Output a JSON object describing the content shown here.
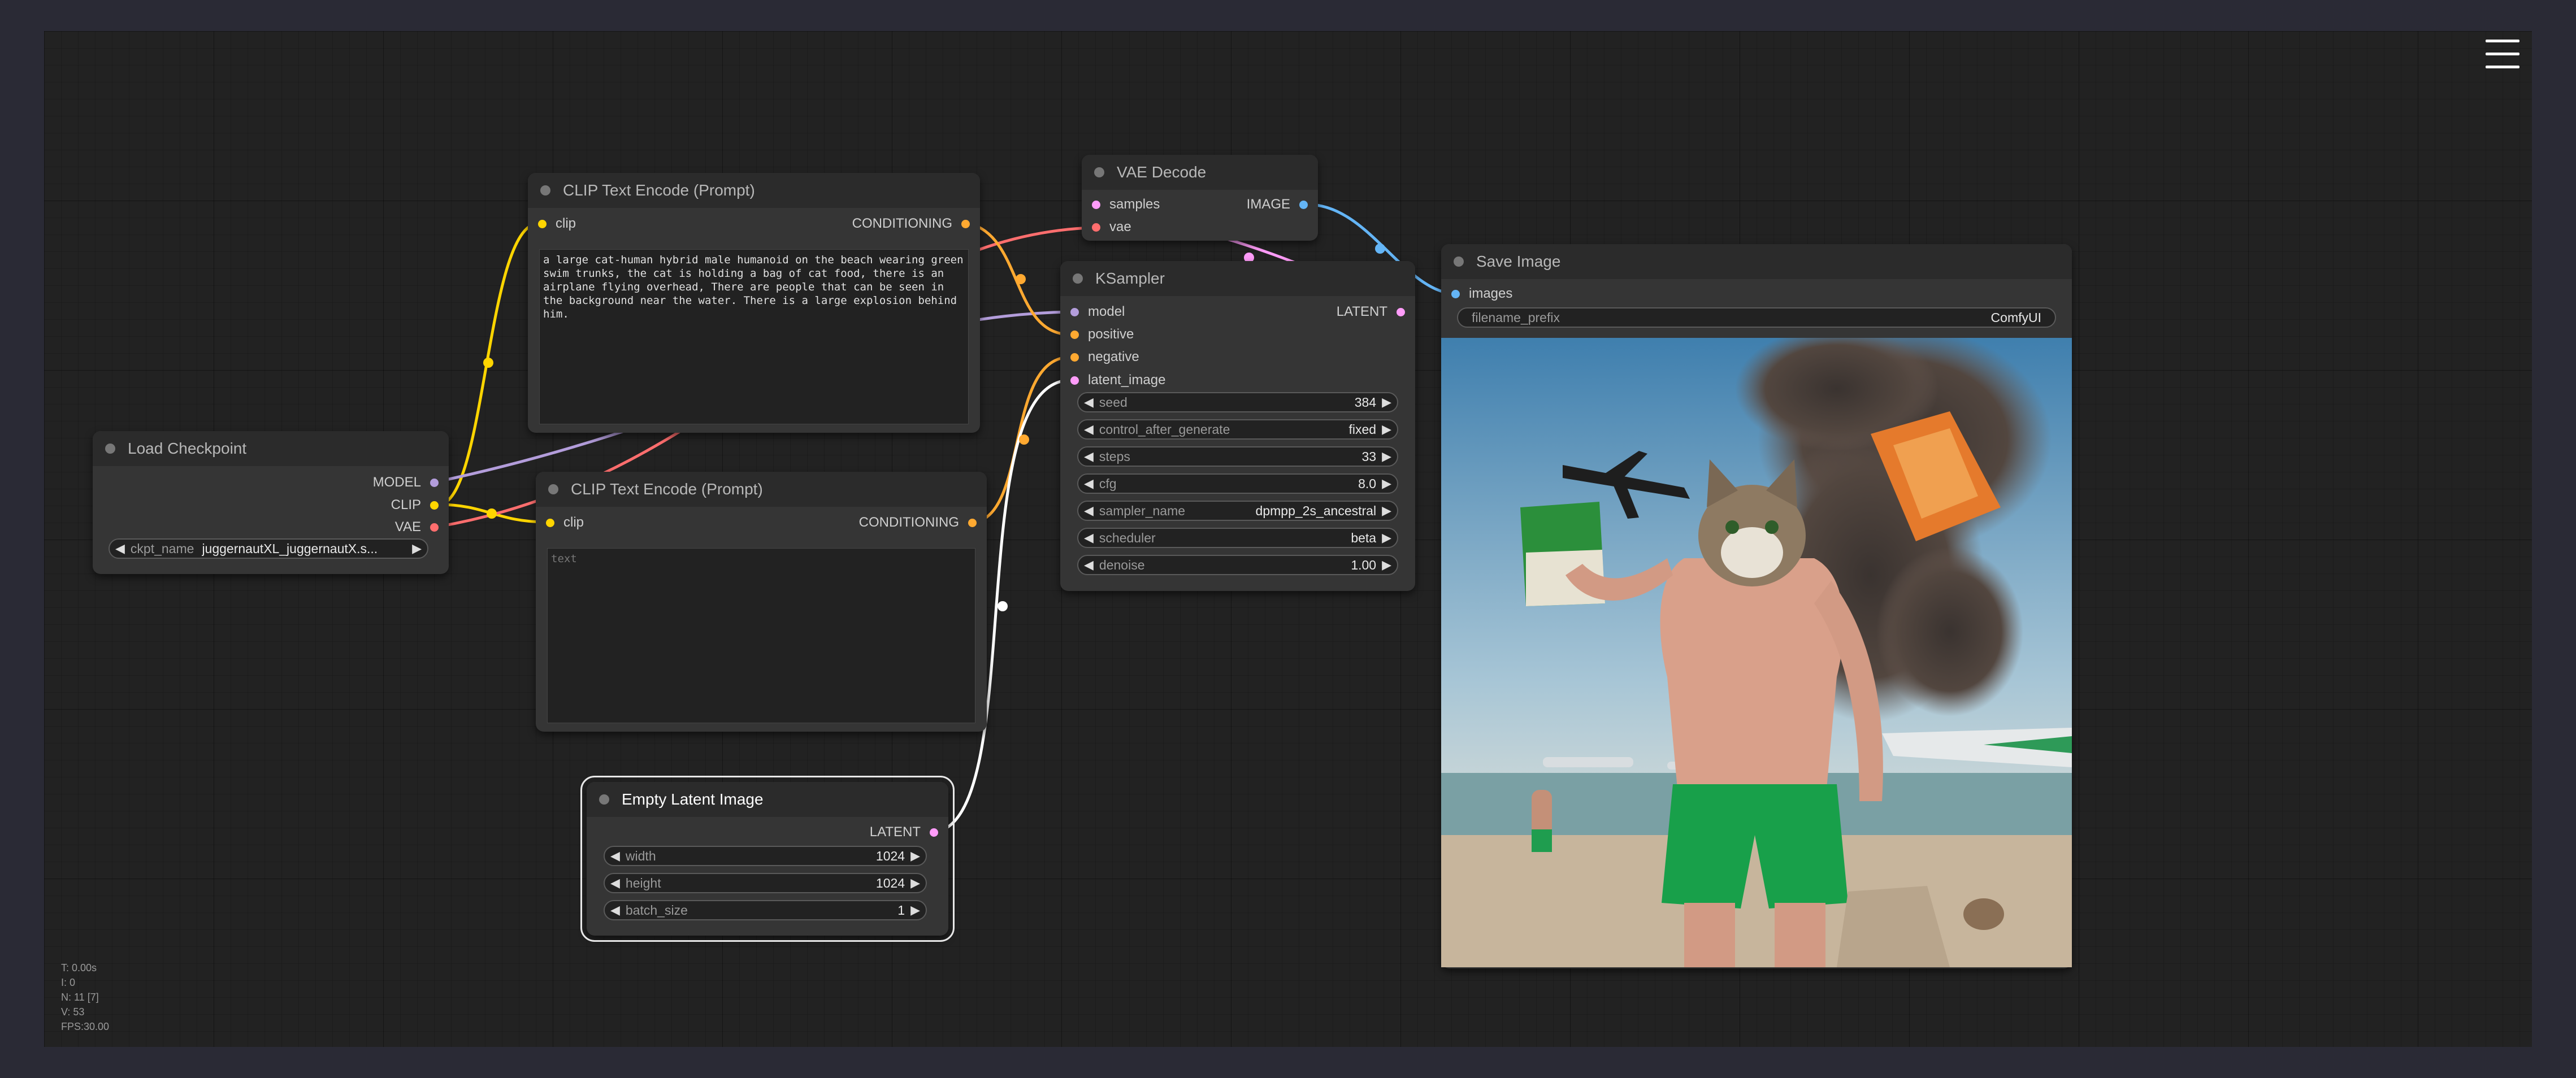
{
  "app": {
    "menu_icon": "hamburger-menu-icon"
  },
  "colors": {
    "clip": "#ffd500",
    "model": "#b39ddb",
    "vae": "#ff6e6e",
    "conditioning": "#ffa931",
    "latent": "#ff9cf9",
    "image": "#64b5f6"
  },
  "load_checkpoint": {
    "title": "Load Checkpoint",
    "outputs": [
      "MODEL",
      "CLIP",
      "VAE"
    ],
    "ckpt_label": "ckpt_name",
    "ckpt_value": "juggernautXL_juggernautX.s..."
  },
  "clip_pos": {
    "title": "CLIP Text Encode (Prompt)",
    "input": "clip",
    "output": "CONDITIONING",
    "text": "a large cat-human hybrid male humanoid on the beach wearing green swim trunks, the cat is holding a bag of cat food, there is an airplane flying overhead, There are people that can be seen in the background near the water. There is a large explosion behind him."
  },
  "clip_neg": {
    "title": "CLIP Text Encode (Prompt)",
    "input": "clip",
    "output": "CONDITIONING",
    "placeholder": "text"
  },
  "empty_latent": {
    "title": "Empty Latent Image",
    "output": "LATENT",
    "widgets": [
      {
        "label": "width",
        "value": "1024"
      },
      {
        "label": "height",
        "value": "1024"
      },
      {
        "label": "batch_size",
        "value": "1"
      }
    ]
  },
  "vae_decode": {
    "title": "VAE Decode",
    "inputs": [
      "samples",
      "vae"
    ],
    "output": "IMAGE"
  },
  "ksampler": {
    "title": "KSampler",
    "inputs": [
      "model",
      "positive",
      "negative",
      "latent_image"
    ],
    "output": "LATENT",
    "widgets": [
      {
        "label": "seed",
        "value": "384"
      },
      {
        "label": "control_after_generate",
        "value": "fixed"
      },
      {
        "label": "steps",
        "value": "33"
      },
      {
        "label": "cfg",
        "value": "8.0"
      },
      {
        "label": "sampler_name",
        "value": "dpmpp_2s_ancestral"
      },
      {
        "label": "scheduler",
        "value": "beta"
      },
      {
        "label": "denoise",
        "value": "1.00"
      }
    ]
  },
  "save_image": {
    "title": "Save Image",
    "input": "images",
    "prefix_label": "filename_prefix",
    "prefix_value": "ComfyUI"
  },
  "stats": [
    "T: 0.00s",
    "I: 0",
    "N: 11 [7]",
    "V: 53",
    "FPS:30.00"
  ]
}
